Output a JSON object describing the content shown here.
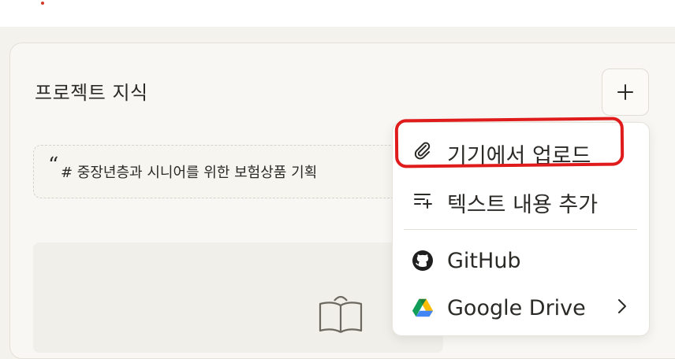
{
  "panel": {
    "title": "프로젝트 지식"
  },
  "add_button": {
    "label": "+"
  },
  "snippet": {
    "quote_mark": "“",
    "text": "# 중장년층과 시니어를 위한 보험상품 기획 "
  },
  "menu": {
    "items": [
      {
        "label": "기기에서 업로드",
        "icon": "paperclip-icon"
      },
      {
        "label": "텍스트 내용 추가",
        "icon": "text-add-icon"
      },
      {
        "label": "GitHub",
        "icon": "github-icon"
      },
      {
        "label": "Google Drive",
        "icon": "google-drive-icon"
      }
    ]
  },
  "colors": {
    "highlight": "#e01b1b",
    "accent_dot": "#d13a2a"
  }
}
